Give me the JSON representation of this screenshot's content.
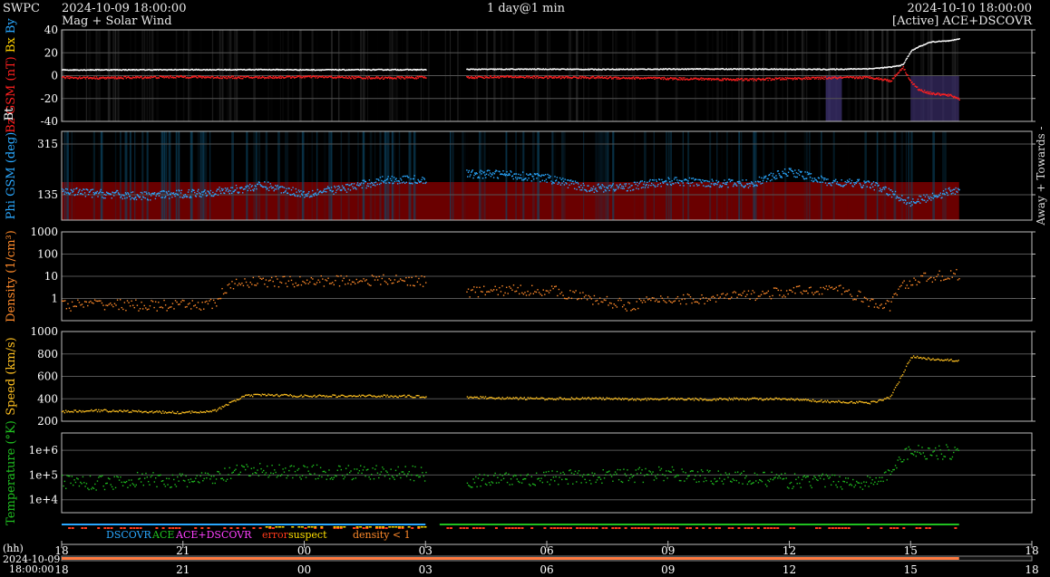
{
  "header": {
    "brand": "SWPC",
    "start_time": "2024-10-09 18:00:00",
    "subtitle": "Mag + Solar Wind",
    "resolution": "1 day@1 min",
    "end_time": "2024-10-10 18:00:00",
    "source": "[Active] ACE+DSCOVR"
  },
  "legend": {
    "dscovr": "DSCOVR",
    "ace": "ACE",
    "ace_dscovr": "ACE+DSCOVR",
    "error": "error",
    "suspect": "suspect",
    "density_low": "density < 1"
  },
  "axis": {
    "hh_label": "(hh)",
    "date_label": "2024-10-09",
    "time_label": "18:00:00",
    "right_label": "Away + Towards -"
  },
  "colors": {
    "bt": "#ffffff",
    "bz": "#ff2020",
    "bx": "#ffd000",
    "by": "#2aa8ff",
    "phi": "#2aa8ff",
    "phi_fill": "#6a0000",
    "density": "#ff8a2a",
    "speed": "#ffc020",
    "temperature": "#20c020",
    "dscovr": "#2aa8ff",
    "ace": "#20c020",
    "ace_dscovr": "#ff40ff",
    "error": "#ff3a1a",
    "suspect": "#ffe000",
    "density_low": "#ff8a2a"
  },
  "chart_data": [
    {
      "type": "scatter",
      "panel": "mag",
      "ylabel_parts": [
        "Bz GSM (nT)",
        "Bx",
        "By",
        "Bt"
      ],
      "ylim": [
        -40,
        40
      ],
      "yticks": [
        -40,
        -20,
        0,
        20,
        40
      ],
      "x_hours": [
        0,
        1,
        2,
        3,
        4,
        5,
        6,
        7,
        8,
        9,
        9.25,
        10,
        11,
        12,
        13,
        14,
        15,
        16,
        17,
        18,
        19,
        20,
        20.5,
        20.8,
        21,
        21.2,
        21.5,
        22,
        22.2
      ],
      "series": [
        {
          "key": "bt",
          "values": [
            5.5,
            5.6,
            5.6,
            5.7,
            5.7,
            5.8,
            5.6,
            5.6,
            5.7,
            5.7,
            null,
            6.0,
            6.1,
            6.2,
            6.0,
            6.1,
            6.2,
            6.3,
            6.2,
            6.1,
            6.0,
            6.6,
            8,
            10,
            22,
            26,
            30,
            31,
            33
          ]
        },
        {
          "key": "bz",
          "values": [
            -1,
            -1.5,
            -1,
            -0.5,
            -1,
            -1,
            -0.5,
            -1,
            -1.5,
            -1,
            null,
            -1,
            -0.5,
            -1,
            -1,
            -1.5,
            -2,
            -2.5,
            -3,
            -2,
            -1.5,
            -1,
            -4,
            8,
            -5,
            -12,
            -15,
            -17,
            -20
          ]
        }
      ]
    },
    {
      "type": "scatter",
      "panel": "phi",
      "ylabel": "Phi GSM (deg)",
      "ylim": [
        45,
        360
      ],
      "yticks": [
        135,
        315
      ],
      "x_hours": [
        0,
        1,
        2,
        3,
        4,
        5,
        6,
        7,
        8,
        9,
        9.25,
        10,
        11,
        12,
        13,
        14,
        15,
        16,
        17,
        18,
        19,
        20,
        21,
        21.5,
        22,
        22.2
      ],
      "values": [
        150,
        140,
        132,
        140,
        150,
        170,
        140,
        160,
        190,
        190,
        null,
        210,
        210,
        195,
        160,
        165,
        185,
        180,
        175,
        220,
        180,
        175,
        110,
        130,
        150,
        160
      ]
    },
    {
      "type": "scatter",
      "panel": "density",
      "ylabel": "Density (1/cm³)",
      "yscale": "log",
      "ylim": [
        0.1,
        1000
      ],
      "yticks": [
        1,
        10,
        100,
        1000
      ],
      "x_hours": [
        0,
        1,
        2,
        3,
        3.8,
        4.5,
        5,
        6,
        7,
        8,
        9,
        9.25,
        10,
        11,
        12,
        13,
        14,
        15,
        16,
        17,
        18,
        19,
        20,
        20.5,
        21,
        21.5,
        22,
        22.2
      ],
      "values": [
        0.5,
        0.6,
        0.5,
        0.5,
        0.6,
        6,
        6,
        6,
        7,
        7,
        6.5,
        null,
        2,
        2.5,
        2.5,
        1,
        0.5,
        1,
        1,
        1.5,
        2,
        3,
        0.6,
        0.5,
        6,
        10,
        12,
        12
      ]
    },
    {
      "type": "scatter",
      "panel": "speed",
      "ylabel": "Speed (km/s)",
      "ylim": [
        200,
        1000
      ],
      "yticks": [
        200,
        400,
        600,
        800,
        1000
      ],
      "x_hours": [
        0,
        1,
        2,
        3,
        3.8,
        4.5,
        5,
        6,
        7,
        8,
        9,
        9.25,
        10,
        11,
        12,
        13,
        14,
        15,
        16,
        17,
        18,
        19,
        20,
        20.5,
        21,
        21.5,
        22,
        22.2
      ],
      "values": [
        290,
        300,
        290,
        280,
        300,
        430,
        440,
        430,
        430,
        430,
        425,
        null,
        420,
        410,
        405,
        410,
        400,
        405,
        400,
        405,
        400,
        380,
        370,
        420,
        780,
        760,
        750,
        740
      ]
    },
    {
      "type": "scatter",
      "panel": "temperature",
      "ylabel": "Temperature (°K)",
      "yscale": "log",
      "ylim": [
        3000,
        5000000
      ],
      "yticks": [
        10000,
        100000,
        1000000
      ],
      "ytick_labels": [
        "1e+4",
        "1e+5",
        "1e+6"
      ],
      "x_hours": [
        0,
        1,
        2,
        3,
        3.8,
        4.5,
        5,
        6,
        7,
        8,
        9,
        9.25,
        10,
        11,
        12,
        13,
        14,
        15,
        16,
        17,
        18,
        19,
        20,
        20.5,
        21,
        21.5,
        22,
        22.2
      ],
      "values": [
        60000,
        50000,
        70000,
        60000,
        80000,
        150000,
        160000,
        140000,
        130000,
        130000,
        120000,
        null,
        60000,
        70000,
        80000,
        90000,
        100000,
        120000,
        90000,
        80000,
        60000,
        60000,
        50000,
        100000,
        1000000,
        900000,
        900000,
        950000
      ]
    }
  ],
  "time_axis": {
    "labels": [
      "18",
      "21",
      "00",
      "03",
      "06",
      "09",
      "12",
      "15",
      "18"
    ],
    "hours": [
      0,
      3,
      6,
      9,
      12,
      15,
      18,
      21,
      24
    ]
  }
}
